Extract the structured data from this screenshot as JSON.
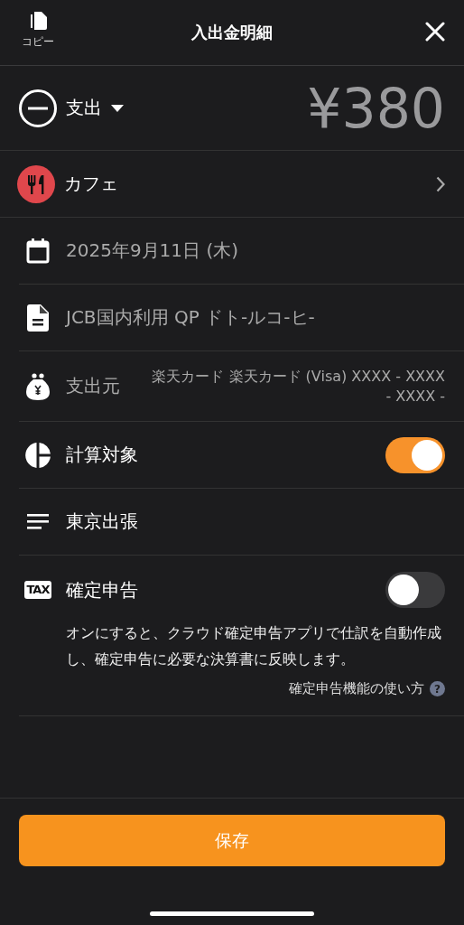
{
  "header": {
    "copy_label": "コピー",
    "title": "入出金明細"
  },
  "entry": {
    "type_label": "支出",
    "amount": "¥380"
  },
  "rows": [
    {
      "kind": "category",
      "label": "カフェ"
    },
    {
      "kind": "date",
      "label": "2025年9月11日 (木)"
    },
    {
      "kind": "memo",
      "label": "JCB国内利用 QP ドト-ルコ-ヒ-"
    },
    {
      "kind": "source",
      "label": "支出元",
      "value": "楽天カード 楽天カード (Visa) XXXX - XXXX - XXXX -"
    },
    {
      "kind": "calc",
      "label": "計算対象",
      "on": true
    },
    {
      "kind": "note",
      "label": "東京出張"
    },
    {
      "kind": "tax",
      "badge": "TAX",
      "label": "確定申告",
      "on": false,
      "description": "オンにすると、クラウド確定申告アプリで仕訳を自動作成し、確定申告に必要な決算書に反映します。",
      "help_link": "確定申告機能の使い方",
      "help_mark": "?"
    }
  ],
  "save_button": "保存"
}
